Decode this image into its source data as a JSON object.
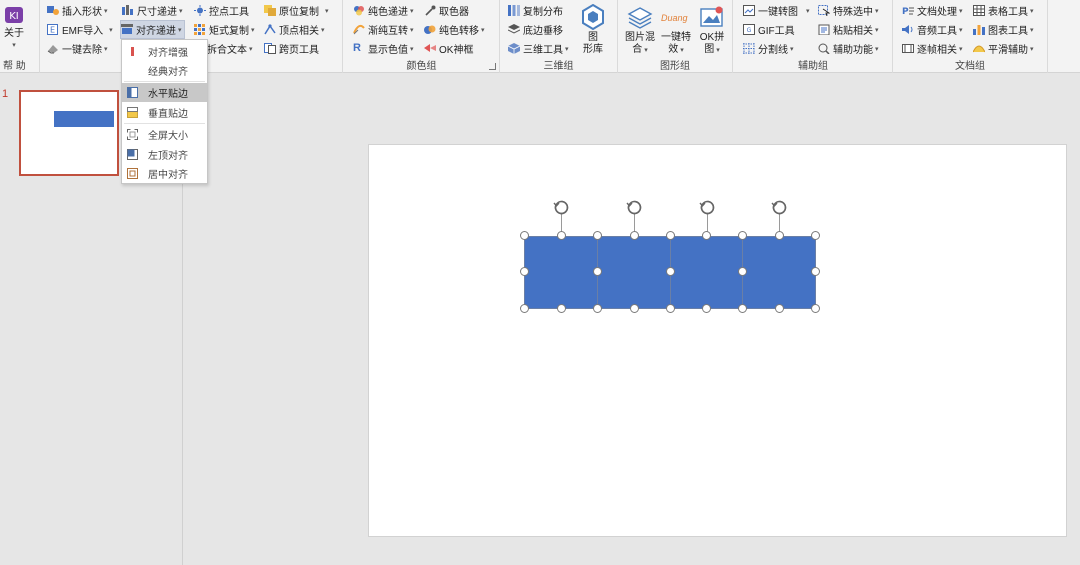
{
  "ribbon": {
    "help_group": {
      "about_label": "关于",
      "label": "帮 助"
    },
    "group1": {
      "row1": {
        "insert_shape": "插入形状",
        "size_step": "尺寸递进",
        "control_point": "控点工具",
        "origin_copy": "原位复制"
      },
      "row2": {
        "emf_import": "EMF导入",
        "align_step": "对齐递进",
        "matrix_copy": "矩式复制",
        "vertex": "顶点相关"
      },
      "row3": {
        "one_key_remove": "一键去除",
        "split_text": "拆合文本",
        "cross_page": "跨页工具"
      }
    },
    "color_group": {
      "label": "颜色组",
      "solid_step": "纯色递进",
      "color_picker": "取色器",
      "gradient_swap": "渐纯互转",
      "solid_transform": "纯色转移",
      "show_color": "显示色值",
      "ok_eyedropper": "OK神框"
    },
    "threed_group": {
      "label": "三维组",
      "copy_dist": "复制分布",
      "base_vertical": "底边垂移",
      "three_d_tools": "三维工具",
      "gallery_1": "图",
      "gallery_2": "形库"
    },
    "shape_group": {
      "label": "图形组",
      "pic_mix_1": "图片混",
      "pic_mix_2": "合",
      "effect_1": "一键特",
      "effect_2": "效",
      "ok_puzzle_1": "OK拼",
      "ok_puzzle_2": "图",
      "duang": "Duang"
    },
    "aux_group": {
      "label": "辅助组",
      "to_image": "一键转图",
      "special_select": "特殊选中",
      "gif_tool": "GIF工具",
      "paste_related": "粘贴相关",
      "split_line": "分割线",
      "aux_func": "辅助功能"
    },
    "doc_group": {
      "label": "文档组",
      "doc_process": "文档处理",
      "table_tools": "表格工具",
      "audio_tools": "音频工具",
      "chart_tools": "图表工具",
      "frame_related": "逐帧相关",
      "smooth_aux": "平滑辅助"
    }
  },
  "dropdown": {
    "items": [
      "对齐增强",
      "经典对齐",
      "水平贴边",
      "垂直贴边",
      "全屏大小",
      "左顶对齐",
      "居中对齐"
    ],
    "selected_index": 2
  },
  "slides": {
    "number": "1"
  },
  "colors": {
    "accent_red": "#c0392b",
    "shape_blue": "#4472c4",
    "selected_item": "#c8c8c8"
  }
}
